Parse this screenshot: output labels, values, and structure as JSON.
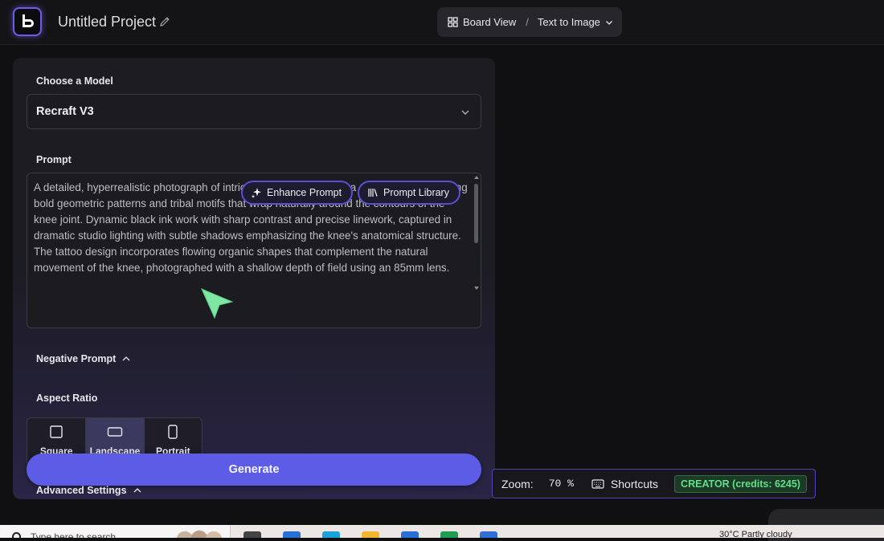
{
  "app": {
    "logo_letter": "b",
    "project_title": "Untitled Project",
    "view_label": "Board View",
    "breadcrumb_sep": "/",
    "mode_label": "Text to Image"
  },
  "panel": {
    "model_label": "Choose a Model",
    "model_value": "Recraft V3",
    "prompt_label": "Prompt",
    "prompt_text": "A detailed, hyperrealistic photograph of intricate knee tattoo art on a male subject, featuring bold geometric patterns and tribal motifs that wrap naturally around the contours of the knee joint. Dynamic black ink work with sharp contrast and precise linework, captured in dramatic studio lighting with subtle shadows emphasizing the knee's anatomical structure. The tattoo design incorporates flowing organic shapes that complement the natural movement of the knee, photographed with a shallow depth of field using an 85mm lens.",
    "enhance_label": "Enhance Prompt",
    "library_label": "Prompt Library",
    "negative_label": "Negative Prompt",
    "aspect_label": "Aspect Ratio",
    "aspects": [
      {
        "label": "Square",
        "active": false
      },
      {
        "label": "Landscape",
        "active": true
      },
      {
        "label": "Portrait",
        "active": false
      }
    ],
    "generate_label": "Generate",
    "advanced_label": "Advanced Settings"
  },
  "status": {
    "zoom_label": "Zoom:",
    "zoom_value": "70 %",
    "shortcuts_label": "Shortcuts",
    "credits_label": "CREATOR (credits: 6245)"
  },
  "taskbar": {
    "search_placeholder": "Type here to search",
    "right_text": "30°C  Partly cloudy"
  },
  "colors": {
    "accent": "#5d5ce6",
    "pill_border": "#5b4ed6",
    "credits_green": "#5ee08a",
    "cursor_green": "#7ee8a2"
  }
}
